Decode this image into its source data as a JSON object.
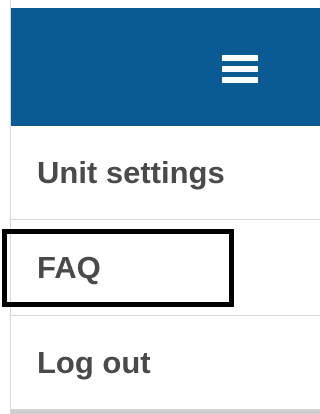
{
  "header": {
    "menu_icon": "hamburger-menu-icon",
    "background_color": "#0a5b93"
  },
  "menu": {
    "items": [
      {
        "label": "Unit settings"
      },
      {
        "label": "FAQ",
        "highlighted": true
      },
      {
        "label": "Log out"
      }
    ]
  },
  "colors": {
    "text": "#4a4a4a",
    "highlight_border": "#000000"
  }
}
